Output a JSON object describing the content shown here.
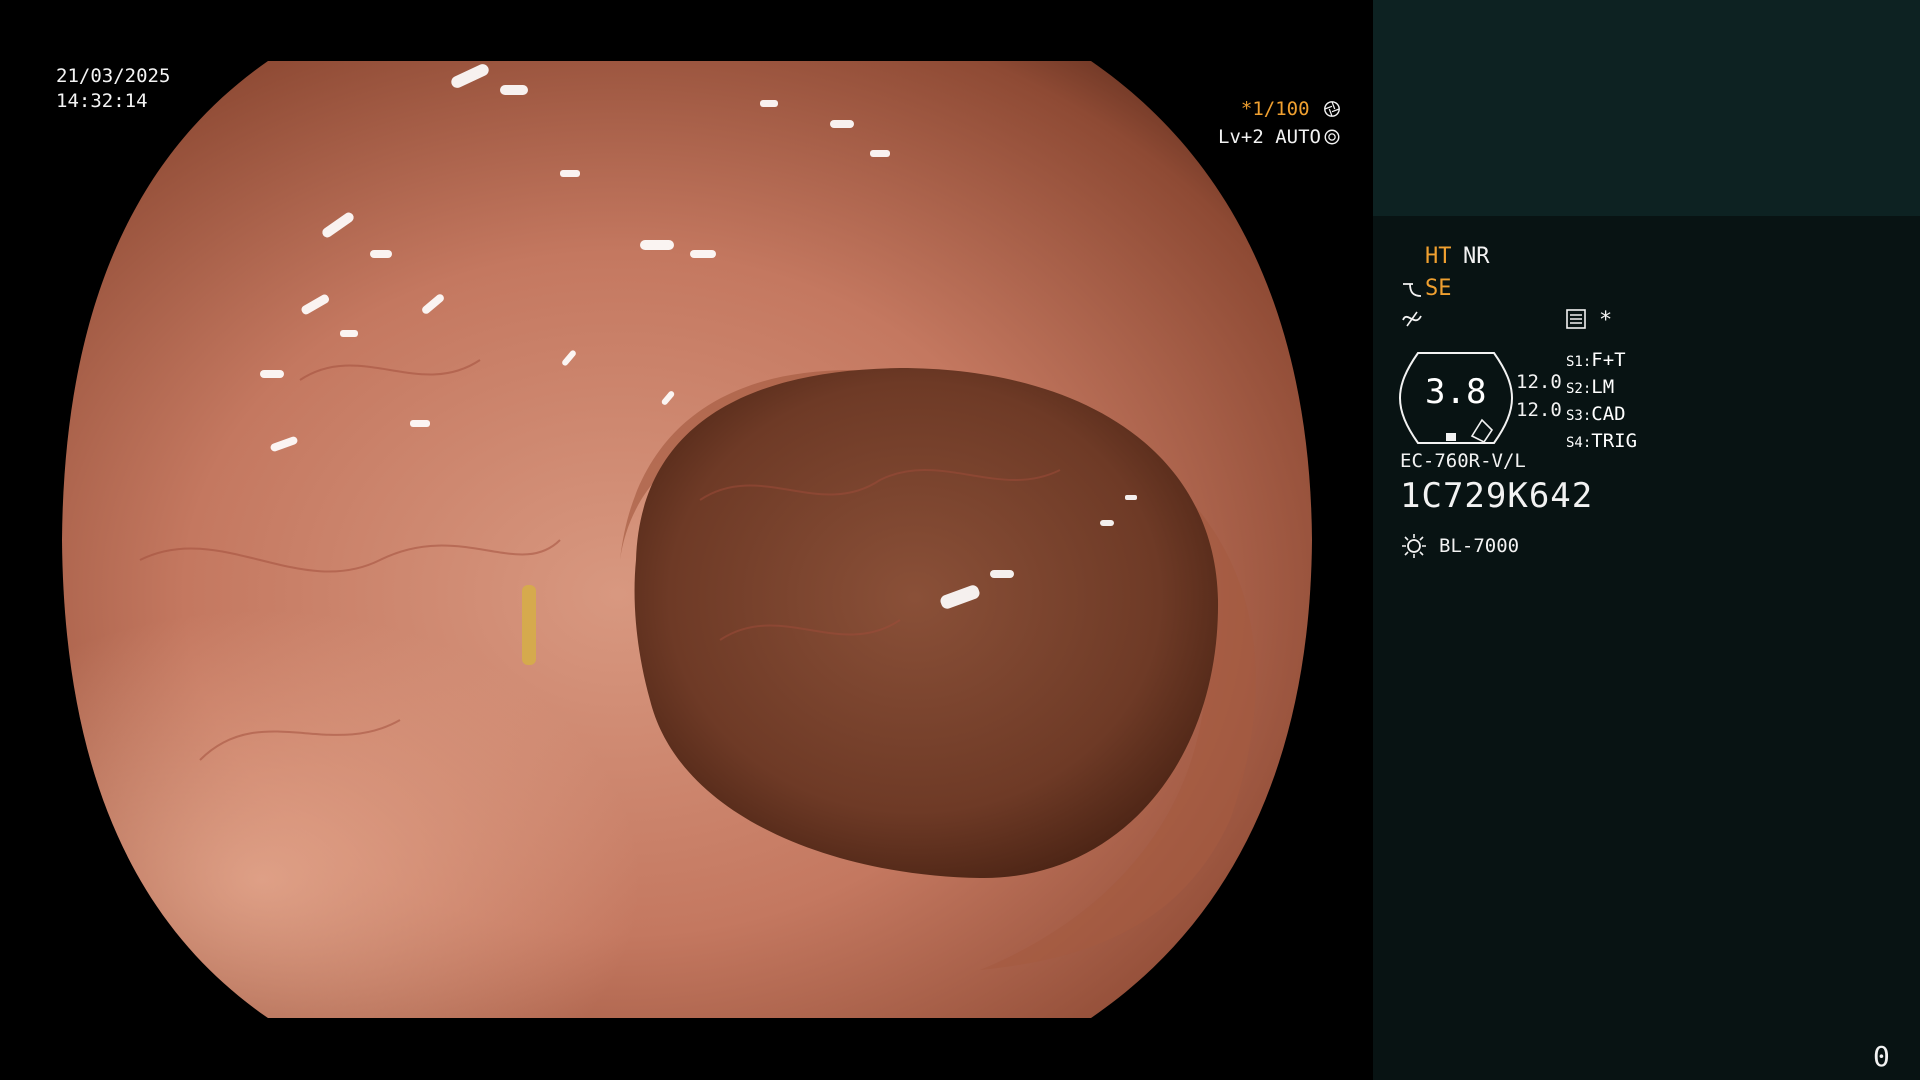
{
  "overlay": {
    "date": "21/03/2025",
    "time": "14:32:14",
    "shutter_prefix": "*",
    "shutter_value": "1/100",
    "level_value": "Lv+2",
    "auto_label": "AUTO"
  },
  "panel": {
    "ht_label": "HT",
    "nr_label": "NR",
    "se_label": "SE",
    "asterisk": "*",
    "zoom_value": "3.8",
    "value_a": "12.0",
    "value_b": "12.0",
    "switches": [
      {
        "key": "S1",
        "value": "F+T"
      },
      {
        "key": "S2",
        "value": "LM"
      },
      {
        "key": "S3",
        "value": "CAD"
      },
      {
        "key": "S4",
        "value": "TRIG"
      }
    ],
    "scope_model": "EC-760R-V/L",
    "scope_serial": "1C729K642",
    "light_source": "BL-7000",
    "counter": "0"
  },
  "colors": {
    "panel_bg": "#081313",
    "thumb_bg": "#0d2222",
    "accent_orange": "#f0a030",
    "text_white": "#f2f2f2"
  },
  "icons": [
    "shutter-aperture-icon",
    "auto-gear-icon",
    "edge-enhance-icon",
    "color-tone-icon",
    "menu-list-icon",
    "lamp-icon"
  ]
}
